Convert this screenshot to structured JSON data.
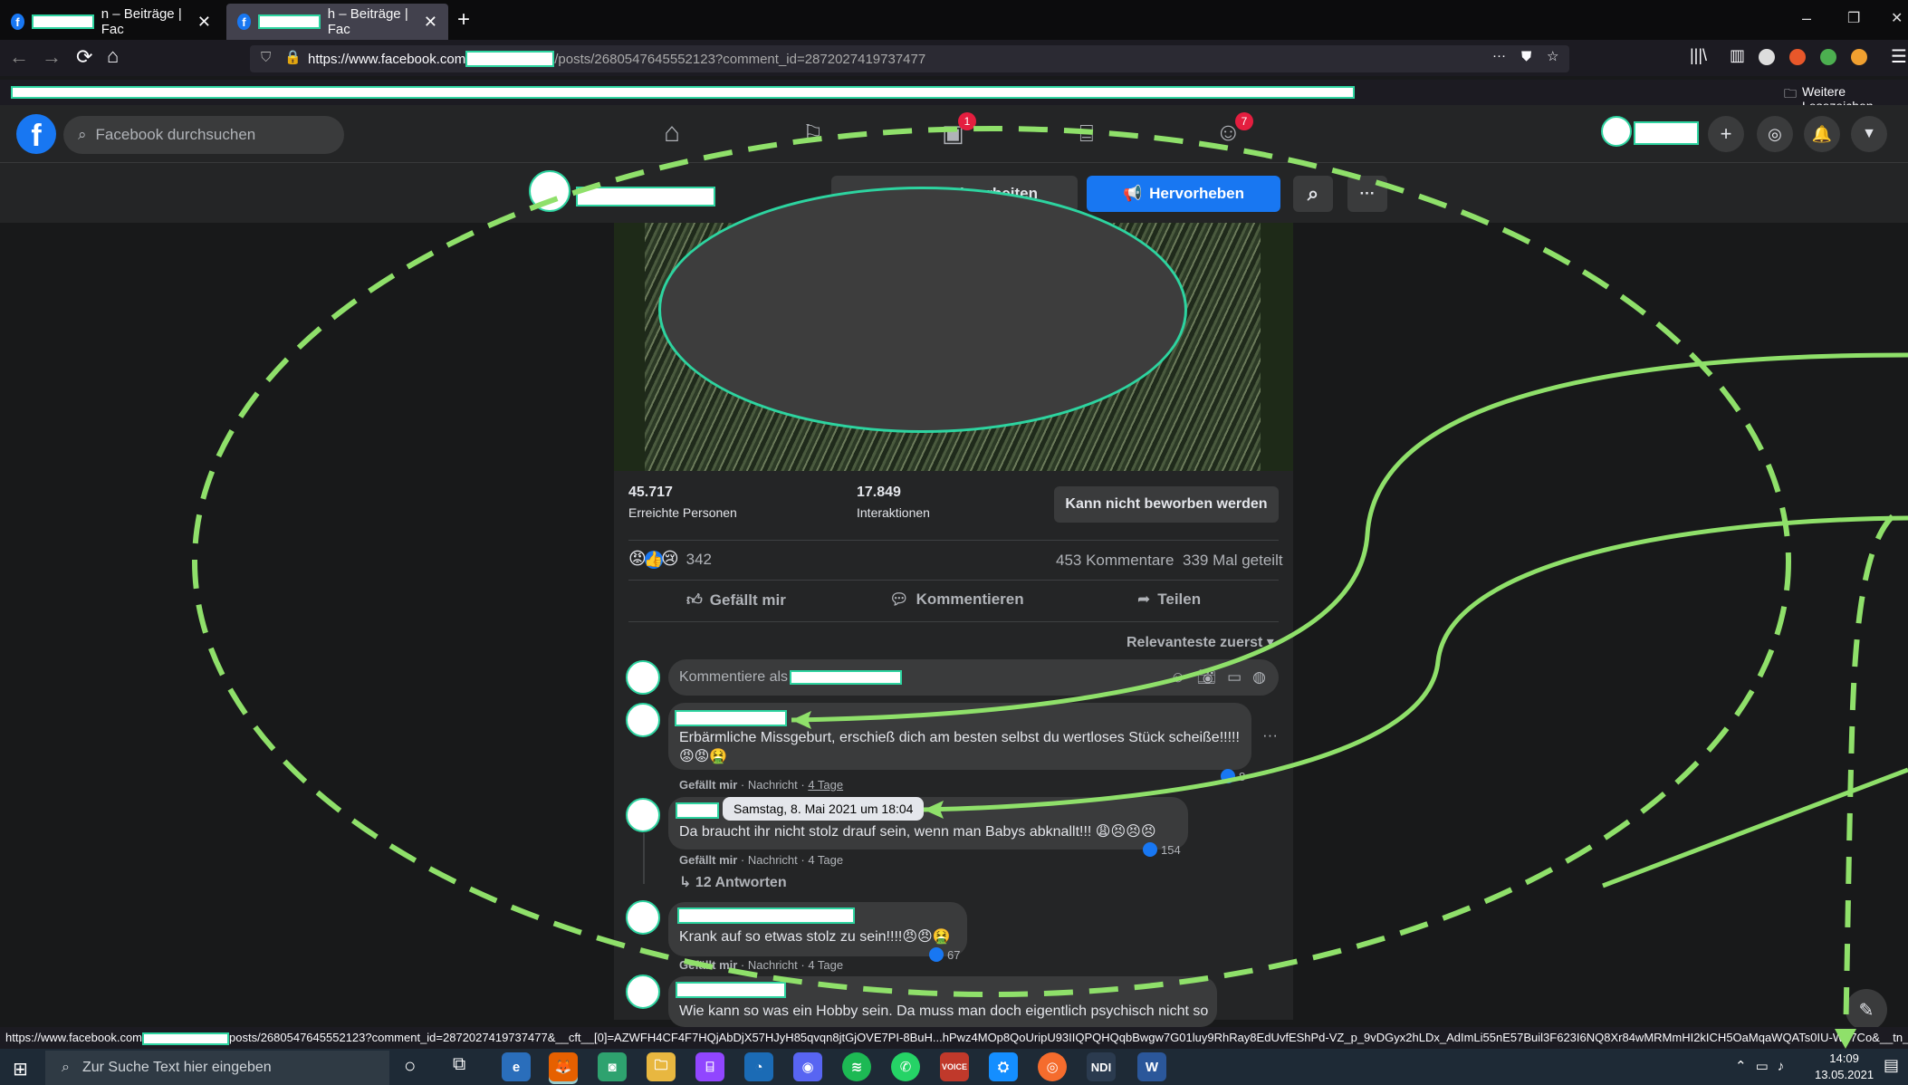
{
  "browser": {
    "tabs": [
      {
        "label": "n – Beiträge | Fac"
      },
      {
        "label": "h – Beiträge | Fac"
      }
    ],
    "new_tab": "+",
    "url_prefix": "https://www.facebook.com",
    "url_suffix": "/posts/2680547645552123?comment_id=2872027419737477",
    "url_menu": "···",
    "bookmarks_other": "Weitere Lesezeichen",
    "status_url_prefix": "https://www.facebook.com",
    "status_url_suffix": "posts/2680547645552123?comment_id=2872027419737477&__cft__[0]=AZWFH4CF4F7HQjAbDjX57HJyH85qvqn8jtGjOVE7PI-8BuH...hPwz4MOp8QoUripU93IIQPQHQqbBwgw7G01luy9RhRay8EdUvfEShPd-VZ_p_9vDGyx2hLDx_AdImLi55nE57Buil3F623I6NQ8Xr84wMRMmHI2kICH5OaMqaWQATs0IU-W57Co&__tn__=R]-R"
  },
  "facebook": {
    "logo": "f",
    "search_placeholder": "Facebook durchsuchen",
    "nav_badges": {
      "watch": "1",
      "groups": "7"
    },
    "page_header": {
      "edit_label": "bearbeiten",
      "promote_label": "Hervorheben",
      "more_label": "···"
    },
    "post": {
      "reach_value": "45.717",
      "reach_label": "Erreichte Personen",
      "interactions_value": "17.849",
      "interactions_label": "Interaktionen",
      "promote_disabled": "Kann nicht beworben werden",
      "reaction_count": "342",
      "comment_count": "453 Kommentare",
      "share_count": "339 Mal geteilt",
      "like_label": "Gefällt mir",
      "comment_label": "Kommentieren",
      "share_label": "Teilen",
      "sort_label": "Relevanteste zuerst",
      "comment_placeholder": "Kommentiere als"
    },
    "comments": [
      {
        "text": "Erbärmliche Missgeburt, erschieß dich am besten selbst du wertloses Stück scheiße!!!!!😡😡🤮",
        "like": "Gefällt mir",
        "rest": " · Nachricht · ",
        "age": "4 Tage",
        "reacts": "8",
        "more": "···"
      },
      {
        "text": "Da braucht ihr nicht stolz drauf sein, wenn man Babys abknallt!!! 😩😣😣😣",
        "like": "Gefällt mir",
        "rest": " · Nachricht · ",
        "age": "4 Tage",
        "reacts": "154",
        "tooltip": "Samstag, 8. Mai 2021 um 18:04",
        "replies": "↳ 12 Antworten"
      },
      {
        "text": "Krank auf so etwas stolz zu sein!!!!😠😠🤮",
        "like": "Gefällt mir",
        "rest": " · Nachricht · ",
        "age": "4 Tage",
        "reacts": "67"
      },
      {
        "text": "Wie kann so was ein Hobby sein. Da muss man doch eigentlich psychisch nicht so"
      }
    ]
  },
  "taskbar": {
    "search_placeholder": "Zur Suche Text hier eingeben",
    "time": "14:09",
    "date": "13.05.2021",
    "apps": [
      "Edge",
      "Firefox",
      "Discord",
      "Explorer",
      "Twitch",
      "Steam",
      "Discord",
      "Spotify",
      "WhatsApp",
      "Voicemeeter",
      "Battle.net",
      "Origin",
      "NDI",
      "Word"
    ]
  },
  "colors": {
    "fb_blue": "#1877f2",
    "dark_bg": "#18191a",
    "card": "#242526",
    "annotation_green": "#8fe06a",
    "redaction_border": "#2dd4a0"
  }
}
